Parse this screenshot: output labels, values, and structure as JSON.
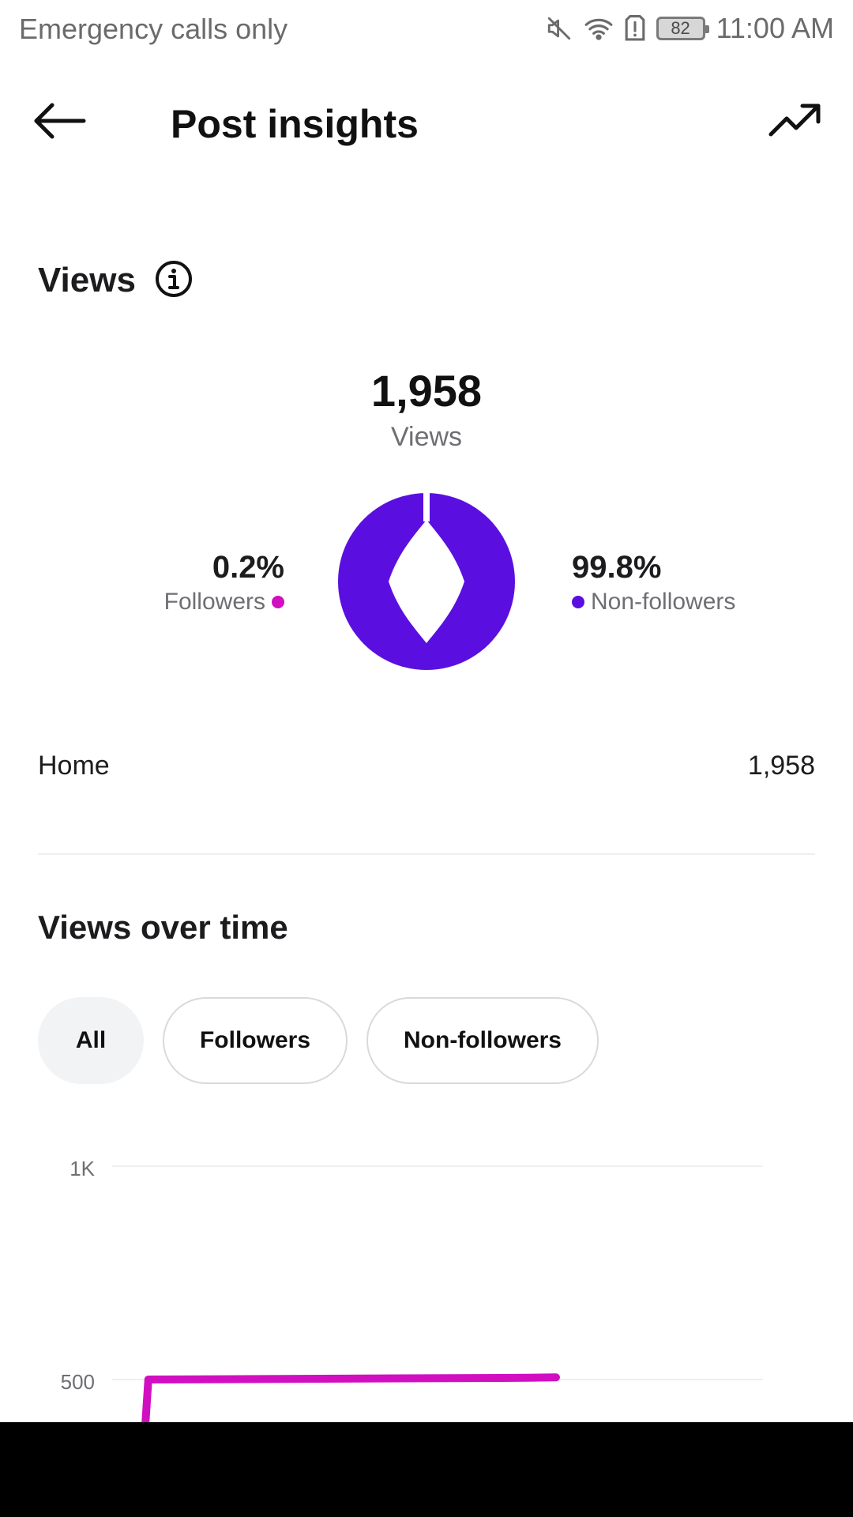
{
  "status_bar": {
    "carrier": "Emergency calls only",
    "battery": "82",
    "time": "11:00 AM",
    "icons": [
      "mute-icon",
      "wifi-icon",
      "sim-alert-icon",
      "battery-icon"
    ]
  },
  "header": {
    "title": "Post insights",
    "back_icon": "arrow-left-icon",
    "trend_icon": "trending-up-icon"
  },
  "views": {
    "heading": "Views",
    "info_icon": "info-icon",
    "total": "1,958",
    "total_label": "Views",
    "followers_pct": "0.2%",
    "followers_label": "Followers",
    "nonfollowers_pct": "99.8%",
    "nonfollowers_label": "Non-followers",
    "colors": {
      "followers": "#d10fc1",
      "nonfollowers": "#5a0fe0"
    },
    "source": {
      "label": "Home",
      "value": "1,958"
    }
  },
  "views_over_time": {
    "heading": "Views over time",
    "filters": [
      {
        "label": "All",
        "active": true
      },
      {
        "label": "Followers",
        "active": false
      },
      {
        "label": "Non-followers",
        "active": false
      }
    ]
  },
  "chart_data": {
    "type": "line",
    "y_ticks": [
      "1K",
      "500"
    ],
    "ylim": [
      0,
      1000
    ],
    "grid": true,
    "series": [
      {
        "color": "#d10fc1",
        "points": [
          {
            "x": 0,
            "y": 0
          },
          {
            "x": 0.02,
            "y": 500
          },
          {
            "x": 0.56,
            "y": 504
          },
          {
            "x": 0.6,
            "y": 505
          }
        ]
      }
    ]
  }
}
